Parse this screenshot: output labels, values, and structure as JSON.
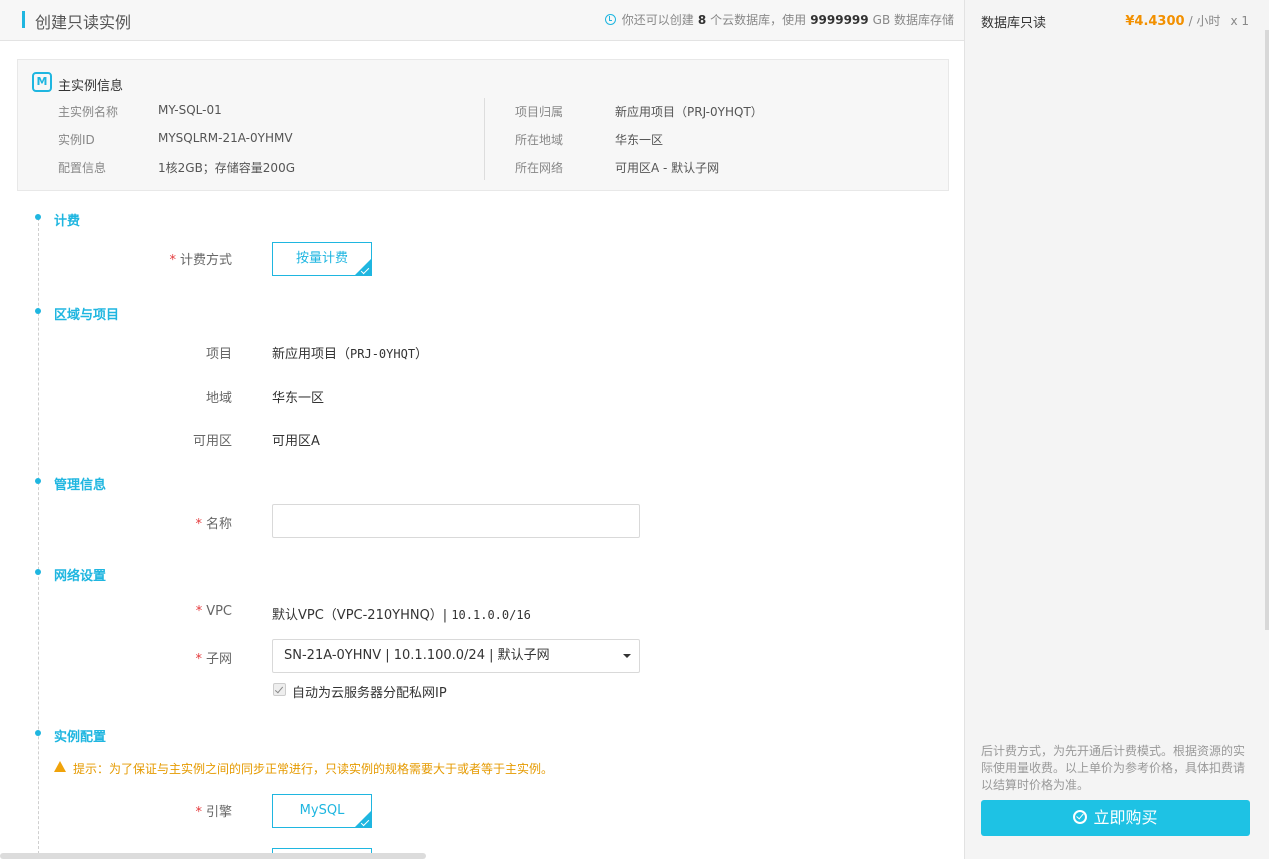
{
  "header": {
    "title": "创建只读实例",
    "quota_prefix": "你还可以创建",
    "quota_count": "8",
    "quota_middle": "个云数据库，使用",
    "quota_storage": "9999999",
    "quota_suffix": "GB 数据库存储"
  },
  "master": {
    "title": "主实例信息",
    "icon_text": "M",
    "left": [
      {
        "label": "主实例名称",
        "value": "MY-SQL-01"
      },
      {
        "label": "实例ID",
        "value": "MYSQLRM-21A-0YHMV"
      },
      {
        "label": "配置信息",
        "value": "1核2GB；存储容量200G"
      }
    ],
    "right": [
      {
        "label": "项目归属",
        "value": "新应用项目（PRJ-0YHQT）"
      },
      {
        "label": "所在地域",
        "value": "华东一区"
      },
      {
        "label": "所在网络",
        "value": "可用区A - 默认子网"
      }
    ]
  },
  "billing": {
    "section": "计费",
    "label": "计费方式",
    "option": "按量计费"
  },
  "region": {
    "section": "区域与项目",
    "project_label": "项目",
    "project_value": "新应用项目（",
    "project_code": "PRJ-0YHQT",
    "project_close": "）",
    "region_label": "地域",
    "region_value": "华东一区",
    "zone_label": "可用区",
    "zone_value": "可用区A"
  },
  "management": {
    "section": "管理信息",
    "name_label": "名称",
    "name_value": "",
    "name_placeholder": ""
  },
  "network": {
    "section": "网络设置",
    "vpc_label": "VPC",
    "vpc_value": "默认VPC（VPC-210YHNQ）|",
    "vpc_cidr": "10.1.0.0/16",
    "subnet_label": "子网",
    "subnet_value": "SN-21A-0YHNV | 10.1.100.0/24 | 默认子网",
    "auto_ip_label": "自动为云服务器分配私网IP",
    "auto_ip_checked": true
  },
  "instance": {
    "section": "实例配置",
    "warning": "提示：为了保证与主实例之间的同步正常进行，只读实例的规格需要大于或者等于主实例。",
    "engine_label": "引擎",
    "engine_option": "MySQL"
  },
  "summary": {
    "title": "数据库只读",
    "price": "¥4.4300",
    "unit": "/ 小时",
    "qty": "x 1",
    "note": "后计费方式，为先开通后计费模式。根据资源的实际使用量收费。以上单价为参考价格，具体扣费请以结算时价格为准。",
    "buy_label": "立即购买"
  },
  "colors": {
    "accent": "#1fb6e0",
    "price": "#f29000",
    "warning": "#e59a00",
    "required": "#e4393c"
  }
}
